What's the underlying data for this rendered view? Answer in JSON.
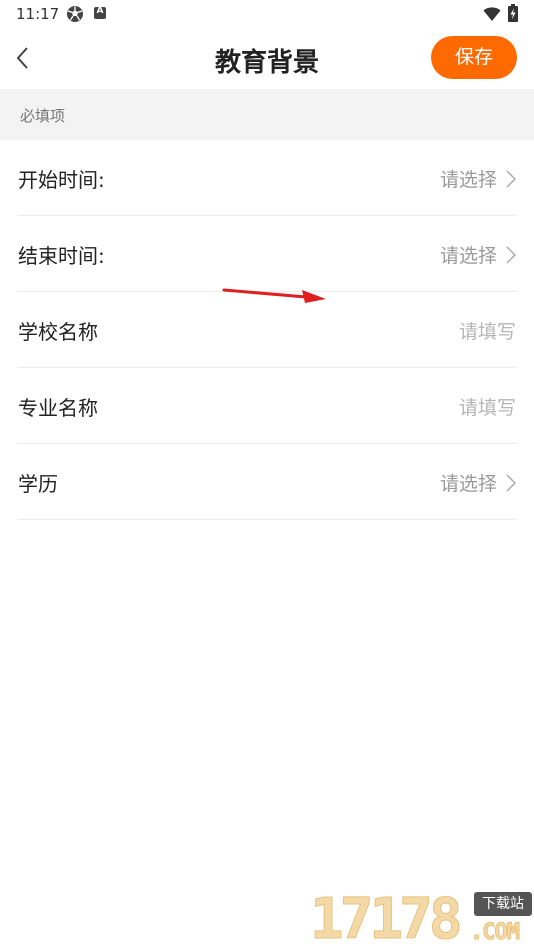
{
  "status_bar": {
    "time": "11:17"
  },
  "header": {
    "title": "教育背景",
    "save_label": "保存"
  },
  "section": {
    "label": "必填项"
  },
  "rows": [
    {
      "label": "开始时间:",
      "value": "请选择",
      "has_arrow": true
    },
    {
      "label": "结束时间:",
      "value": "请选择",
      "has_arrow": true
    },
    {
      "label": "学校名称",
      "value": "请填写",
      "has_arrow": false
    },
    {
      "label": "专业名称",
      "value": "请填写",
      "has_arrow": false
    },
    {
      "label": "学历",
      "value": "请选择",
      "has_arrow": true
    }
  ],
  "watermark": {
    "digits": "17178",
    "badge": "下载站",
    "domain": ".COM"
  },
  "colors": {
    "accent": "#ff6a00",
    "section_bg": "#f3f3f3",
    "annotation": "#e02020"
  }
}
